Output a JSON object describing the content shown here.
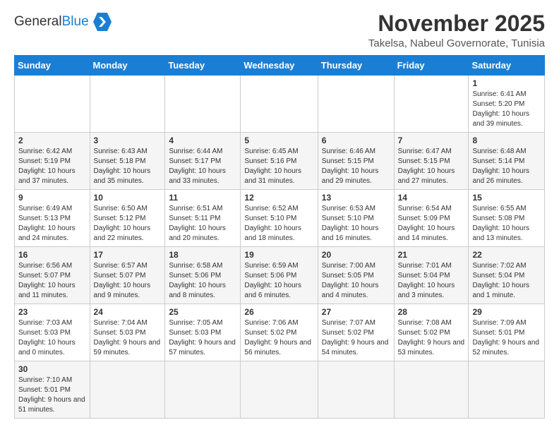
{
  "header": {
    "logo_general": "General",
    "logo_blue": "Blue",
    "month_title": "November 2025",
    "location": "Takelsa, Nabeul Governorate, Tunisia"
  },
  "weekdays": [
    "Sunday",
    "Monday",
    "Tuesday",
    "Wednesday",
    "Thursday",
    "Friday",
    "Saturday"
  ],
  "weeks": [
    [
      {
        "day": "",
        "info": ""
      },
      {
        "day": "",
        "info": ""
      },
      {
        "day": "",
        "info": ""
      },
      {
        "day": "",
        "info": ""
      },
      {
        "day": "",
        "info": ""
      },
      {
        "day": "",
        "info": ""
      },
      {
        "day": "1",
        "info": "Sunrise: 6:41 AM\nSunset: 5:20 PM\nDaylight: 10 hours and 39 minutes."
      }
    ],
    [
      {
        "day": "2",
        "info": "Sunrise: 6:42 AM\nSunset: 5:19 PM\nDaylight: 10 hours and 37 minutes."
      },
      {
        "day": "3",
        "info": "Sunrise: 6:43 AM\nSunset: 5:18 PM\nDaylight: 10 hours and 35 minutes."
      },
      {
        "day": "4",
        "info": "Sunrise: 6:44 AM\nSunset: 5:17 PM\nDaylight: 10 hours and 33 minutes."
      },
      {
        "day": "5",
        "info": "Sunrise: 6:45 AM\nSunset: 5:16 PM\nDaylight: 10 hours and 31 minutes."
      },
      {
        "day": "6",
        "info": "Sunrise: 6:46 AM\nSunset: 5:15 PM\nDaylight: 10 hours and 29 minutes."
      },
      {
        "day": "7",
        "info": "Sunrise: 6:47 AM\nSunset: 5:15 PM\nDaylight: 10 hours and 27 minutes."
      },
      {
        "day": "8",
        "info": "Sunrise: 6:48 AM\nSunset: 5:14 PM\nDaylight: 10 hours and 26 minutes."
      }
    ],
    [
      {
        "day": "9",
        "info": "Sunrise: 6:49 AM\nSunset: 5:13 PM\nDaylight: 10 hours and 24 minutes."
      },
      {
        "day": "10",
        "info": "Sunrise: 6:50 AM\nSunset: 5:12 PM\nDaylight: 10 hours and 22 minutes."
      },
      {
        "day": "11",
        "info": "Sunrise: 6:51 AM\nSunset: 5:11 PM\nDaylight: 10 hours and 20 minutes."
      },
      {
        "day": "12",
        "info": "Sunrise: 6:52 AM\nSunset: 5:10 PM\nDaylight: 10 hours and 18 minutes."
      },
      {
        "day": "13",
        "info": "Sunrise: 6:53 AM\nSunset: 5:10 PM\nDaylight: 10 hours and 16 minutes."
      },
      {
        "day": "14",
        "info": "Sunrise: 6:54 AM\nSunset: 5:09 PM\nDaylight: 10 hours and 14 minutes."
      },
      {
        "day": "15",
        "info": "Sunrise: 6:55 AM\nSunset: 5:08 PM\nDaylight: 10 hours and 13 minutes."
      }
    ],
    [
      {
        "day": "16",
        "info": "Sunrise: 6:56 AM\nSunset: 5:07 PM\nDaylight: 10 hours and 11 minutes."
      },
      {
        "day": "17",
        "info": "Sunrise: 6:57 AM\nSunset: 5:07 PM\nDaylight: 10 hours and 9 minutes."
      },
      {
        "day": "18",
        "info": "Sunrise: 6:58 AM\nSunset: 5:06 PM\nDaylight: 10 hours and 8 minutes."
      },
      {
        "day": "19",
        "info": "Sunrise: 6:59 AM\nSunset: 5:06 PM\nDaylight: 10 hours and 6 minutes."
      },
      {
        "day": "20",
        "info": "Sunrise: 7:00 AM\nSunset: 5:05 PM\nDaylight: 10 hours and 4 minutes."
      },
      {
        "day": "21",
        "info": "Sunrise: 7:01 AM\nSunset: 5:04 PM\nDaylight: 10 hours and 3 minutes."
      },
      {
        "day": "22",
        "info": "Sunrise: 7:02 AM\nSunset: 5:04 PM\nDaylight: 10 hours and 1 minute."
      }
    ],
    [
      {
        "day": "23",
        "info": "Sunrise: 7:03 AM\nSunset: 5:03 PM\nDaylight: 10 hours and 0 minutes."
      },
      {
        "day": "24",
        "info": "Sunrise: 7:04 AM\nSunset: 5:03 PM\nDaylight: 9 hours and 59 minutes."
      },
      {
        "day": "25",
        "info": "Sunrise: 7:05 AM\nSunset: 5:03 PM\nDaylight: 9 hours and 57 minutes."
      },
      {
        "day": "26",
        "info": "Sunrise: 7:06 AM\nSunset: 5:02 PM\nDaylight: 9 hours and 56 minutes."
      },
      {
        "day": "27",
        "info": "Sunrise: 7:07 AM\nSunset: 5:02 PM\nDaylight: 9 hours and 54 minutes."
      },
      {
        "day": "28",
        "info": "Sunrise: 7:08 AM\nSunset: 5:02 PM\nDaylight: 9 hours and 53 minutes."
      },
      {
        "day": "29",
        "info": "Sunrise: 7:09 AM\nSunset: 5:01 PM\nDaylight: 9 hours and 52 minutes."
      }
    ],
    [
      {
        "day": "30",
        "info": "Sunrise: 7:10 AM\nSunset: 5:01 PM\nDaylight: 9 hours and 51 minutes."
      },
      {
        "day": "",
        "info": ""
      },
      {
        "day": "",
        "info": ""
      },
      {
        "day": "",
        "info": ""
      },
      {
        "day": "",
        "info": ""
      },
      {
        "day": "",
        "info": ""
      },
      {
        "day": "",
        "info": ""
      }
    ]
  ]
}
